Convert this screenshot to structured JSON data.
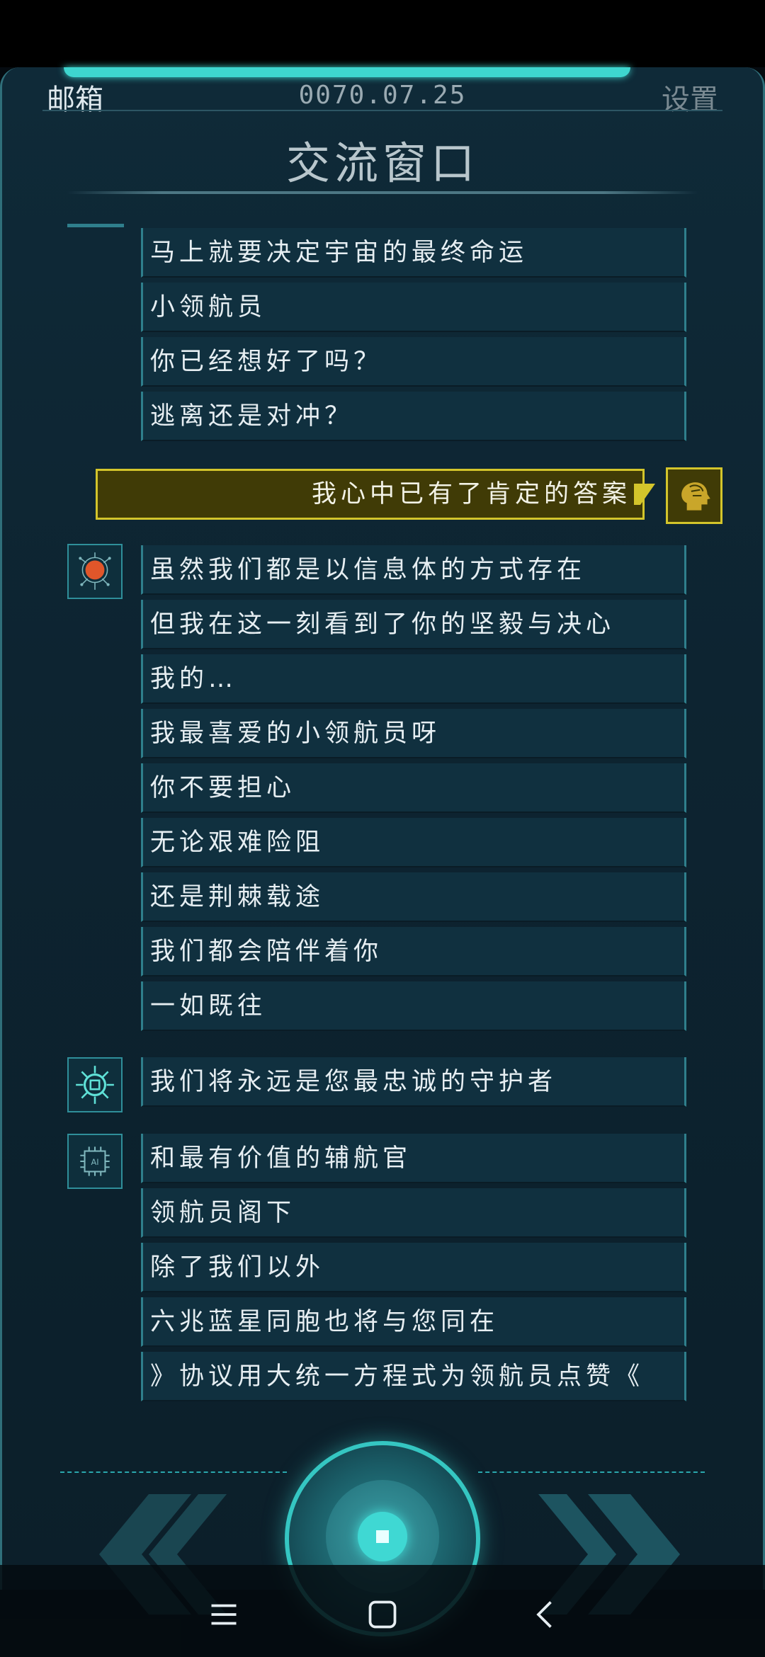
{
  "header": {
    "left_label": "邮箱",
    "date": "0070.07.25",
    "right_label": "设置",
    "title": "交流窗口"
  },
  "group1": {
    "messages": [
      "马上就要决定宇宙的最终命运",
      "小领航员",
      "你已经想好了吗？",
      "逃离还是对冲？"
    ]
  },
  "reply": {
    "text": "我心中已有了肯定的答案",
    "avatar_icon": "brain-head-icon"
  },
  "group2": {
    "avatar_icon": "red-planet-network-icon",
    "messages": [
      "虽然我们都是以信息体的方式存在",
      "但我在这一刻看到了你的坚毅与决心",
      "我的…",
      "我最喜爱的小领航员呀",
      "你不要担心",
      "无论艰难险阻",
      "还是荆棘载途",
      "我们都会陪伴着你",
      "一如既往"
    ]
  },
  "group3": {
    "avatar_icon": "chip-bug-icon",
    "messages": [
      "我们将永远是您最忠诚的守护者"
    ]
  },
  "group4": {
    "avatar_icon": "ai-chip-icon",
    "avatar_text": "AI",
    "messages": [
      "和最有价值的辅航官",
      "领航员阁下",
      "除了我们以外",
      "六兆蓝星同胞也将与您同在",
      "》协议用大统一方程式为领航员点赞《"
    ]
  },
  "colors": {
    "accent": "#3ed6cf",
    "message_bg": "#10303f",
    "reply_bg": "#403b06",
    "reply_border": "#d3c52b"
  }
}
